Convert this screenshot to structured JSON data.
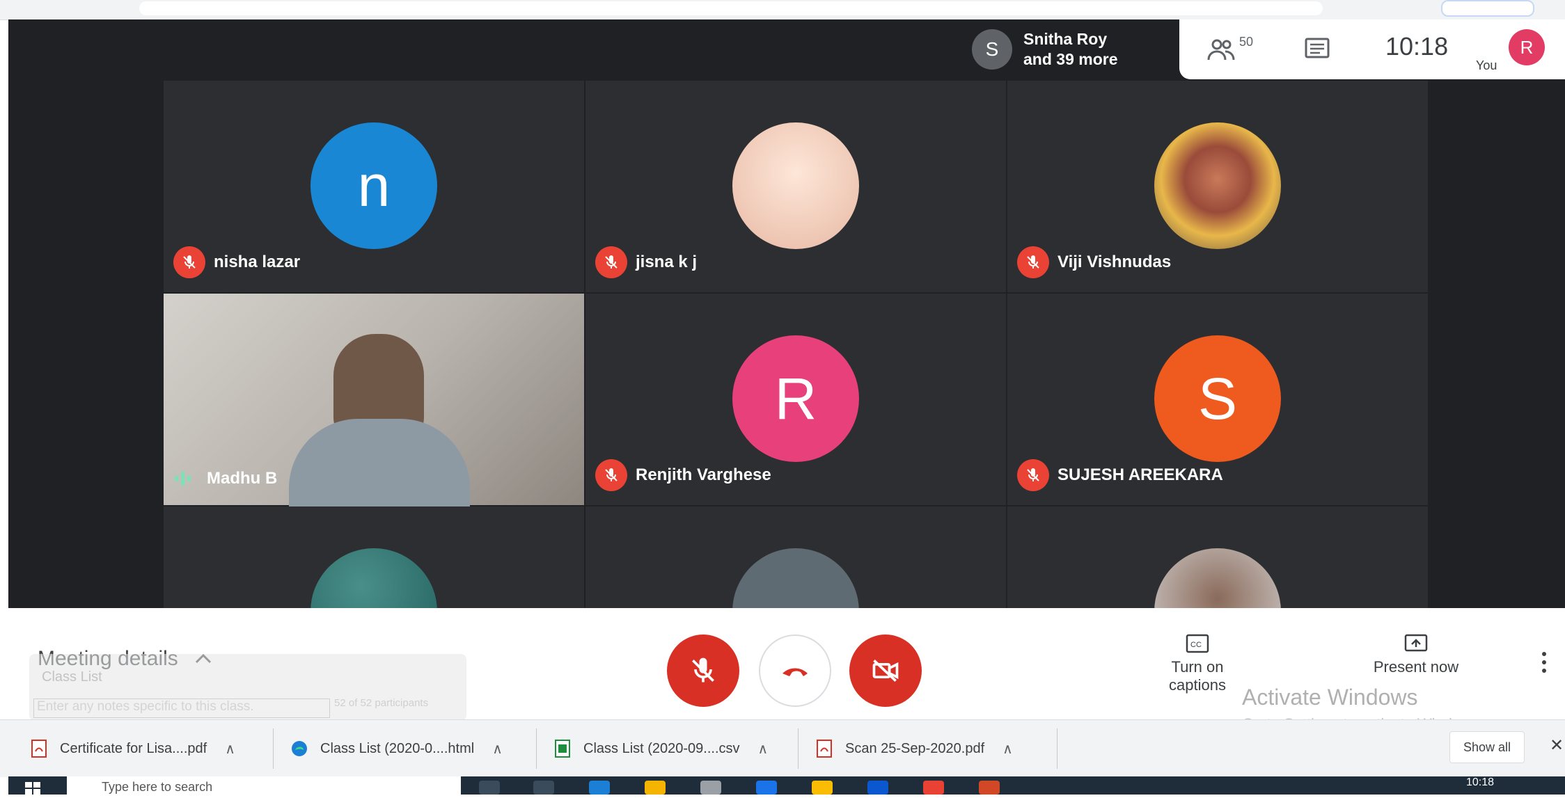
{
  "presenter": {
    "initial": "S",
    "line1": "Snitha Roy",
    "line2": "and 39 more"
  },
  "top_panel": {
    "people_count": "50",
    "time": "10:18",
    "you_label": "You",
    "user_initial": "R"
  },
  "tiles": [
    {
      "name": "nisha lazar",
      "initial": "n",
      "color": "#1a87d4"
    },
    {
      "name": "jisna k j",
      "initial": "",
      "color": "#f0c3ae"
    },
    {
      "name": "Viji Vishnudas",
      "initial": "",
      "color": "#7a5c4a"
    },
    {
      "name": "Madhu B",
      "initial": "",
      "color": "#8a8580"
    },
    {
      "name": "Renjith Varghese",
      "initial": "R",
      "color": "#e8407a"
    },
    {
      "name": "SUJESH AREEKARA",
      "initial": "S",
      "color": "#ef5a1f"
    }
  ],
  "bottom": {
    "meeting_details": "Meeting details",
    "captions_label": "Turn on captions",
    "present_label": "Present now",
    "watermark_title": "Activate Windows",
    "watermark_sub": "Go to Settings to activate Windows.",
    "faded_list": "Class List",
    "faded_notes": "Enter any notes specific to this class.",
    "faded_count": "52 of 52 participants"
  },
  "downloads": [
    {
      "label": "Certificate for Lisa....pdf"
    },
    {
      "label": "Class List (2020-0....html"
    },
    {
      "label": "Class List (2020-09....csv"
    },
    {
      "label": "Scan 25-Sep-2020.pdf"
    }
  ],
  "downloads_show_all": "Show all",
  "taskbar": {
    "search_placeholder": "Type here to search",
    "time": "10:18"
  }
}
